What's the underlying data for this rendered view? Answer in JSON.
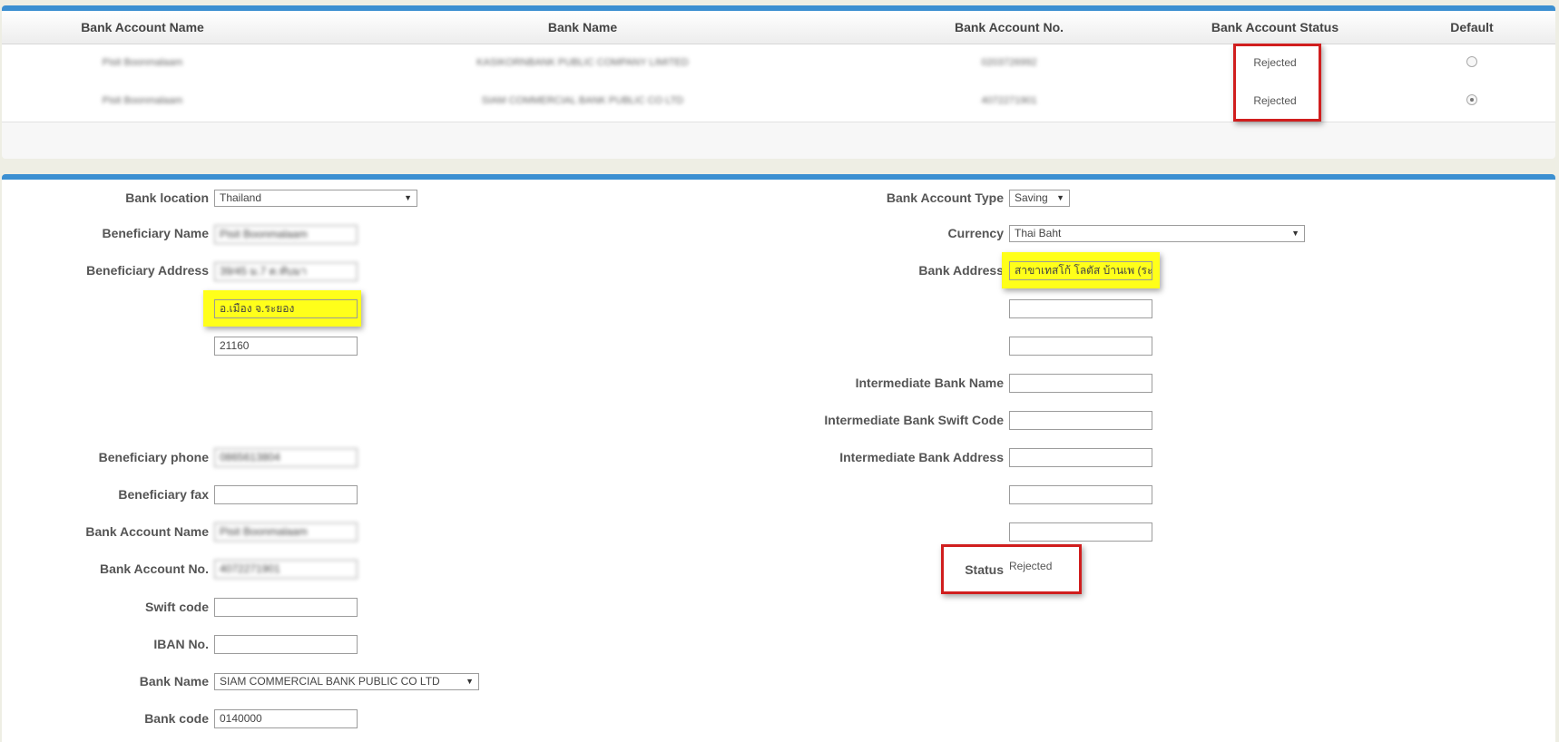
{
  "accounts_table": {
    "headers": {
      "account_name": "Bank Account Name",
      "bank_name": "Bank Name",
      "account_no": "Bank Account No.",
      "status": "Bank Account Status",
      "default": "Default"
    },
    "rows": [
      {
        "account_name": "Pisit Boonmalaam",
        "bank_name": "KASIKORNBANK PUBLIC COMPANY LIMITED",
        "account_no": "0203726992",
        "status": "Rejected",
        "default": false
      },
      {
        "account_name": "Pisit Boonmalaam",
        "bank_name": "SIAM COMMERCIAL BANK PUBLIC CO LTD",
        "account_no": "4072271901",
        "status": "Rejected",
        "default": true
      }
    ]
  },
  "form": {
    "left": {
      "bank_location": {
        "label": "Bank location",
        "value": "Thailand"
      },
      "beneficiary_name": {
        "label": "Beneficiary Name",
        "value": "Pisit Boonmalaam"
      },
      "beneficiary_address": {
        "label": "Beneficiary Address",
        "line1": "39/45 ม.7 ต.ทับมา",
        "line2": "อ.เมือง จ.ระยอง",
        "line3": "21160"
      },
      "beneficiary_phone": {
        "label": "Beneficiary phone",
        "value": "0865613804"
      },
      "beneficiary_fax": {
        "label": "Beneficiary fax",
        "value": ""
      },
      "bank_account_name": {
        "label": "Bank Account Name",
        "value": "Pisit Boonmalaam"
      },
      "bank_account_no": {
        "label": "Bank Account No.",
        "value": "4072271901"
      },
      "swift_code": {
        "label": "Swift code",
        "value": ""
      },
      "iban_no": {
        "label": "IBAN No.",
        "value": ""
      },
      "bank_name": {
        "label": "Bank Name",
        "value": "SIAM COMMERCIAL BANK PUBLIC CO LTD"
      },
      "bank_code": {
        "label": "Bank code",
        "value": "0140000"
      }
    },
    "right": {
      "bank_account_type": {
        "label": "Bank Account Type",
        "value": "Saving"
      },
      "currency": {
        "label": "Currency",
        "value": "Thai Baht"
      },
      "bank_address": {
        "label": "Bank Address",
        "line1": "สาขาเทสโก้ โลตัส บ้านเพ (ระ",
        "line2": "",
        "line3": ""
      },
      "intermediate_bank_name": {
        "label": "Intermediate Bank Name",
        "value": ""
      },
      "intermediate_bank_swift": {
        "label": "Intermediate Bank Swift Code",
        "value": ""
      },
      "intermediate_bank_address": {
        "label": "Intermediate Bank Address",
        "line1": "",
        "line2": "",
        "line3": ""
      },
      "status": {
        "label": "Status",
        "value": "Rejected"
      }
    }
  },
  "colors": {
    "accent_bar": "#3b8fd1",
    "highlight_yellow": "#ffff1a",
    "annotation_red": "#d01e1e"
  }
}
